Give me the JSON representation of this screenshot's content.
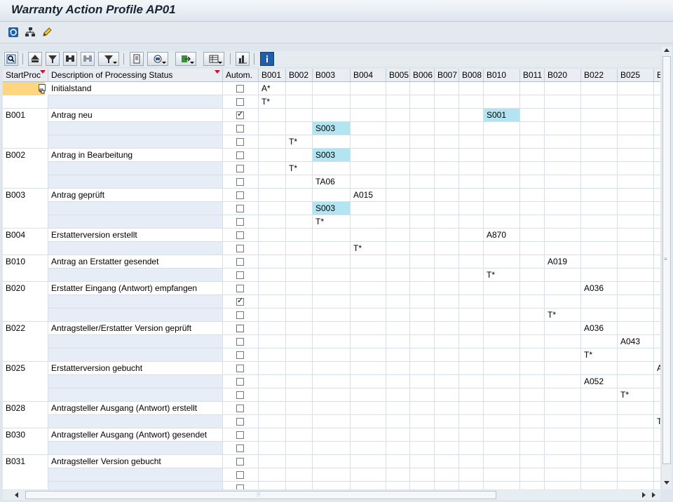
{
  "window": {
    "title": "Warranty Action Profile AP01"
  },
  "app_toolbar": {
    "icons": [
      "refresh-icon",
      "object-hierarchy-icon",
      "edit-pencil-icon"
    ]
  },
  "grid_toolbar": {
    "icons": [
      "details-icon",
      "print-icon",
      "filter-icon",
      "find-icon",
      "find-next-icon",
      "set-filter-icon",
      "print-preview-icon",
      "views-icon",
      "export-icon",
      "layout-icon",
      "graphic-icon",
      "info-icon"
    ]
  },
  "grid": {
    "headers": {
      "start": "StartProc",
      "desc": "Description of Processing Status",
      "autom": "Autom.",
      "cols": [
        "B001",
        "B002",
        "B003",
        "B004",
        "B005",
        "B006",
        "B007",
        "B008",
        "B010",
        "B011",
        "B020",
        "B022",
        "B025",
        "B"
      ]
    },
    "rows": [
      {
        "start": "",
        "desc": "Initialstand",
        "autom": false,
        "cells": {
          "B001": "A*"
        }
      },
      {
        "start": "",
        "desc": "",
        "autom": false,
        "cells": {
          "B001": "T*"
        }
      },
      {
        "start": "B001",
        "desc": "Antrag neu",
        "autom": true,
        "cells": {
          "B010": "S001"
        }
      },
      {
        "start": "",
        "desc": "",
        "autom": false,
        "cells": {
          "B003": "S003"
        }
      },
      {
        "start": "",
        "desc": "",
        "autom": false,
        "cells": {
          "B002": "T*"
        }
      },
      {
        "start": "B002",
        "desc": "Antrag in Bearbeitung",
        "autom": false,
        "cells": {
          "B003": "S003"
        }
      },
      {
        "start": "",
        "desc": "",
        "autom": false,
        "cells": {
          "B002": "T*"
        }
      },
      {
        "start": "",
        "desc": "",
        "autom": false,
        "cells": {
          "B003": "TA06"
        }
      },
      {
        "start": "B003",
        "desc": "Antrag geprüft",
        "autom": false,
        "cells": {
          "B004": "A015"
        }
      },
      {
        "start": "",
        "desc": "",
        "autom": false,
        "cells": {
          "B003": "S003"
        }
      },
      {
        "start": "",
        "desc": "",
        "autom": false,
        "cells": {
          "B003": "T*"
        }
      },
      {
        "start": "B004",
        "desc": "Erstatterversion erstellt",
        "autom": false,
        "cells": {
          "B010": "A870"
        }
      },
      {
        "start": "",
        "desc": "",
        "autom": false,
        "cells": {
          "B004": "T*"
        }
      },
      {
        "start": "B010",
        "desc": "Antrag an Erstatter gesendet",
        "autom": false,
        "cells": {
          "B020": "A019"
        }
      },
      {
        "start": "",
        "desc": "",
        "autom": false,
        "cells": {
          "B010": "T*"
        }
      },
      {
        "start": "B020",
        "desc": "Erstatter Eingang (Antwort) empfangen",
        "autom": false,
        "cells": {
          "B022": "A036"
        }
      },
      {
        "start": "",
        "desc": "",
        "autom": true,
        "cells": {}
      },
      {
        "start": "",
        "desc": "",
        "autom": false,
        "cells": {
          "B020": "T*"
        }
      },
      {
        "start": "B022",
        "desc": "Antragsteller/Erstatter Version geprüft",
        "autom": false,
        "cells": {
          "B022": "A036"
        }
      },
      {
        "start": "",
        "desc": "",
        "autom": false,
        "cells": {
          "B025": "A043"
        }
      },
      {
        "start": "",
        "desc": "",
        "autom": false,
        "cells": {
          "B022": "T*"
        }
      },
      {
        "start": "B025",
        "desc": "Erstatterversion gebucht",
        "autom": false,
        "cells": {
          "B": "A"
        }
      },
      {
        "start": "",
        "desc": "",
        "autom": false,
        "cells": {
          "B022": "A052"
        }
      },
      {
        "start": "",
        "desc": "",
        "autom": false,
        "cells": {
          "B025": "T*"
        }
      },
      {
        "start": "B028",
        "desc": "Antragsteller Ausgang (Antwort) erstellt",
        "autom": false,
        "cells": {}
      },
      {
        "start": "",
        "desc": "",
        "autom": false,
        "cells": {
          "B": "T"
        }
      },
      {
        "start": "B030",
        "desc": "Antragsteller Ausgang (Antwort) gesendet",
        "autom": false,
        "cells": {}
      },
      {
        "start": "",
        "desc": "",
        "autom": false,
        "cells": {}
      },
      {
        "start": "B031",
        "desc": "Antragsteller Version gebucht",
        "autom": false,
        "cells": {}
      },
      {
        "start": "",
        "desc": "",
        "autom": false,
        "cells": {}
      },
      {
        "start": "",
        "desc": "",
        "autom": false,
        "cells": {}
      }
    ],
    "highlighted_value": "S003",
    "highlight_color": "#b2e4f1",
    "selected_cell_color": "#ffd680"
  }
}
